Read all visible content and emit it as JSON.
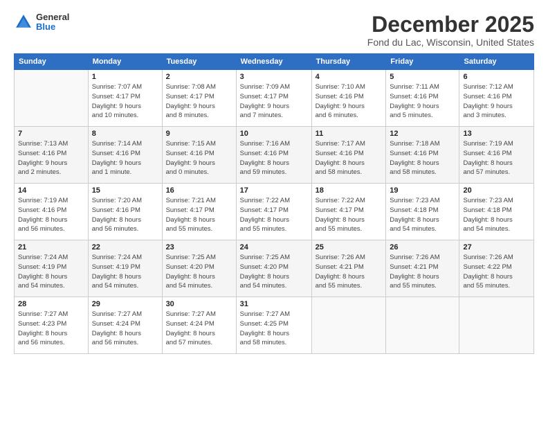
{
  "header": {
    "logo_general": "General",
    "logo_blue": "Blue",
    "month_title": "December 2025",
    "location": "Fond du Lac, Wisconsin, United States"
  },
  "weekdays": [
    "Sunday",
    "Monday",
    "Tuesday",
    "Wednesday",
    "Thursday",
    "Friday",
    "Saturday"
  ],
  "weeks": [
    [
      {
        "day": "",
        "info": ""
      },
      {
        "day": "1",
        "info": "Sunrise: 7:07 AM\nSunset: 4:17 PM\nDaylight: 9 hours\nand 10 minutes."
      },
      {
        "day": "2",
        "info": "Sunrise: 7:08 AM\nSunset: 4:17 PM\nDaylight: 9 hours\nand 8 minutes."
      },
      {
        "day": "3",
        "info": "Sunrise: 7:09 AM\nSunset: 4:17 PM\nDaylight: 9 hours\nand 7 minutes."
      },
      {
        "day": "4",
        "info": "Sunrise: 7:10 AM\nSunset: 4:16 PM\nDaylight: 9 hours\nand 6 minutes."
      },
      {
        "day": "5",
        "info": "Sunrise: 7:11 AM\nSunset: 4:16 PM\nDaylight: 9 hours\nand 5 minutes."
      },
      {
        "day": "6",
        "info": "Sunrise: 7:12 AM\nSunset: 4:16 PM\nDaylight: 9 hours\nand 3 minutes."
      }
    ],
    [
      {
        "day": "7",
        "info": "Sunrise: 7:13 AM\nSunset: 4:16 PM\nDaylight: 9 hours\nand 2 minutes."
      },
      {
        "day": "8",
        "info": "Sunrise: 7:14 AM\nSunset: 4:16 PM\nDaylight: 9 hours\nand 1 minute."
      },
      {
        "day": "9",
        "info": "Sunrise: 7:15 AM\nSunset: 4:16 PM\nDaylight: 9 hours\nand 0 minutes."
      },
      {
        "day": "10",
        "info": "Sunrise: 7:16 AM\nSunset: 4:16 PM\nDaylight: 8 hours\nand 59 minutes."
      },
      {
        "day": "11",
        "info": "Sunrise: 7:17 AM\nSunset: 4:16 PM\nDaylight: 8 hours\nand 58 minutes."
      },
      {
        "day": "12",
        "info": "Sunrise: 7:18 AM\nSunset: 4:16 PM\nDaylight: 8 hours\nand 58 minutes."
      },
      {
        "day": "13",
        "info": "Sunrise: 7:19 AM\nSunset: 4:16 PM\nDaylight: 8 hours\nand 57 minutes."
      }
    ],
    [
      {
        "day": "14",
        "info": "Sunrise: 7:19 AM\nSunset: 4:16 PM\nDaylight: 8 hours\nand 56 minutes."
      },
      {
        "day": "15",
        "info": "Sunrise: 7:20 AM\nSunset: 4:16 PM\nDaylight: 8 hours\nand 56 minutes."
      },
      {
        "day": "16",
        "info": "Sunrise: 7:21 AM\nSunset: 4:17 PM\nDaylight: 8 hours\nand 55 minutes."
      },
      {
        "day": "17",
        "info": "Sunrise: 7:22 AM\nSunset: 4:17 PM\nDaylight: 8 hours\nand 55 minutes."
      },
      {
        "day": "18",
        "info": "Sunrise: 7:22 AM\nSunset: 4:17 PM\nDaylight: 8 hours\nand 55 minutes."
      },
      {
        "day": "19",
        "info": "Sunrise: 7:23 AM\nSunset: 4:18 PM\nDaylight: 8 hours\nand 54 minutes."
      },
      {
        "day": "20",
        "info": "Sunrise: 7:23 AM\nSunset: 4:18 PM\nDaylight: 8 hours\nand 54 minutes."
      }
    ],
    [
      {
        "day": "21",
        "info": "Sunrise: 7:24 AM\nSunset: 4:19 PM\nDaylight: 8 hours\nand 54 minutes."
      },
      {
        "day": "22",
        "info": "Sunrise: 7:24 AM\nSunset: 4:19 PM\nDaylight: 8 hours\nand 54 minutes."
      },
      {
        "day": "23",
        "info": "Sunrise: 7:25 AM\nSunset: 4:20 PM\nDaylight: 8 hours\nand 54 minutes."
      },
      {
        "day": "24",
        "info": "Sunrise: 7:25 AM\nSunset: 4:20 PM\nDaylight: 8 hours\nand 54 minutes."
      },
      {
        "day": "25",
        "info": "Sunrise: 7:26 AM\nSunset: 4:21 PM\nDaylight: 8 hours\nand 55 minutes."
      },
      {
        "day": "26",
        "info": "Sunrise: 7:26 AM\nSunset: 4:21 PM\nDaylight: 8 hours\nand 55 minutes."
      },
      {
        "day": "27",
        "info": "Sunrise: 7:26 AM\nSunset: 4:22 PM\nDaylight: 8 hours\nand 55 minutes."
      }
    ],
    [
      {
        "day": "28",
        "info": "Sunrise: 7:27 AM\nSunset: 4:23 PM\nDaylight: 8 hours\nand 56 minutes."
      },
      {
        "day": "29",
        "info": "Sunrise: 7:27 AM\nSunset: 4:24 PM\nDaylight: 8 hours\nand 56 minutes."
      },
      {
        "day": "30",
        "info": "Sunrise: 7:27 AM\nSunset: 4:24 PM\nDaylight: 8 hours\nand 57 minutes."
      },
      {
        "day": "31",
        "info": "Sunrise: 7:27 AM\nSunset: 4:25 PM\nDaylight: 8 hours\nand 58 minutes."
      },
      {
        "day": "",
        "info": ""
      },
      {
        "day": "",
        "info": ""
      },
      {
        "day": "",
        "info": ""
      }
    ]
  ]
}
